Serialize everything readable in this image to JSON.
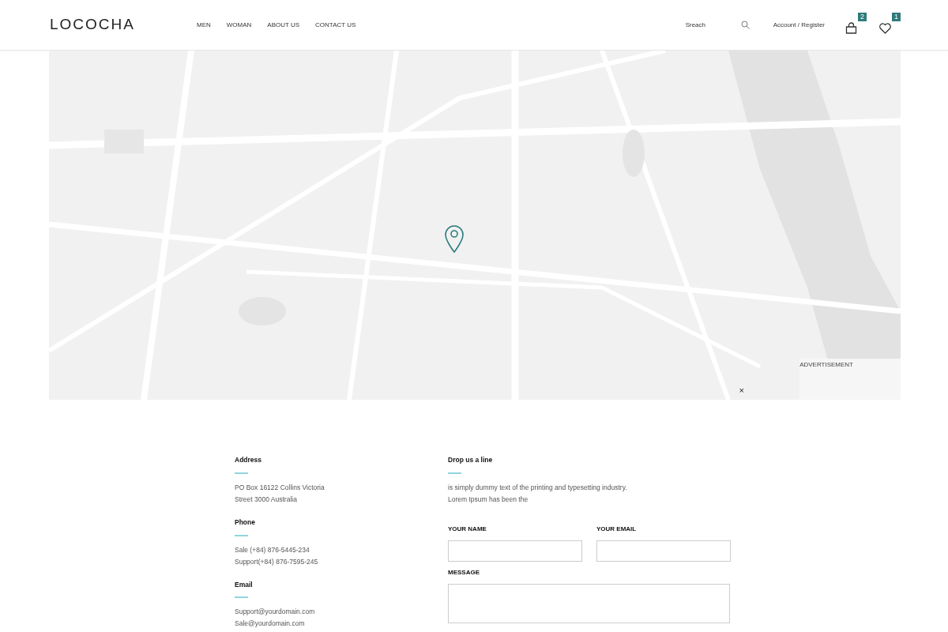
{
  "header": {
    "logo": "LOCOCHA",
    "nav": [
      {
        "label": "MEN"
      },
      {
        "label": "WOMAN"
      },
      {
        "label": "ABOUT US"
      },
      {
        "label": "CONTACT US"
      }
    ],
    "search": {
      "placeholder": "Sreach"
    },
    "account": "Account / Register",
    "cart_count": "2",
    "wishlist_count": "1"
  },
  "map": {
    "kind": "picture",
    "ad_label": "ADVERTISEMENT",
    "ad_close": "×"
  },
  "contact": [
    {
      "heading": "Address",
      "lines": [
        "PO Box 16122 Collins  Victoria",
        "Street 3000 Australia"
      ]
    },
    {
      "heading": "Phone",
      "lines": [
        "Sale (+84) 876-5445-234",
        "Support(+84) 876-7595-245"
      ]
    },
    {
      "heading": "Email",
      "lines": [
        "Support@yourdomain.com",
        "Sale@yourdomain.com"
      ]
    }
  ],
  "form": {
    "heading": "Drop us a line",
    "intro": [
      "is simply dummy text of the printing and typesetting industry.",
      "Lorem Ipsum has been the"
    ],
    "name_label": "YOUR NAME",
    "email_label": "YOUR EMAIL",
    "message_label": "MESSAGE"
  }
}
